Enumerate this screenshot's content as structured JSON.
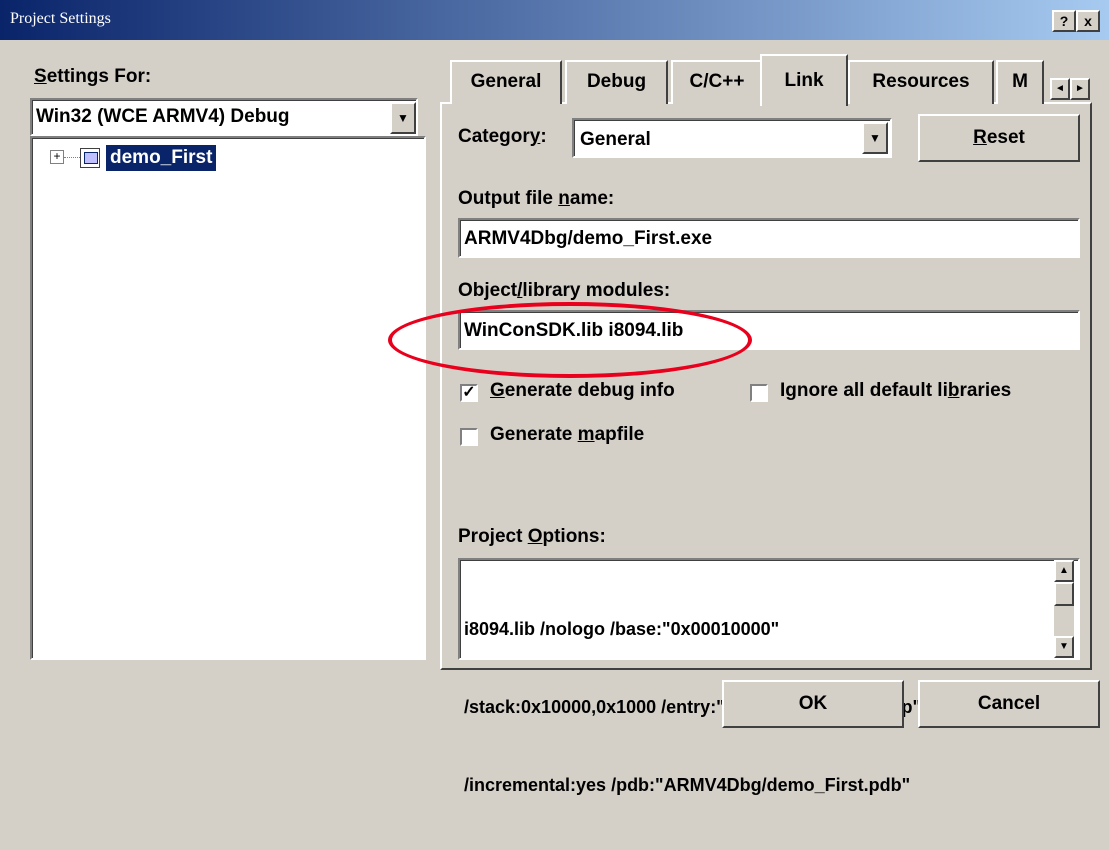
{
  "window": {
    "title": "Project Settings",
    "help_btn": "?",
    "close_btn": "x"
  },
  "left": {
    "settings_for_label": "Settings For:",
    "platform_value": "Win32 (WCE ARMV4) Debug",
    "tree_expander": "⊞",
    "tree_item": "demo_First"
  },
  "tabs": [
    {
      "label": "General"
    },
    {
      "label": "Debug"
    },
    {
      "label": "C/C++"
    },
    {
      "label": "Link"
    },
    {
      "label": "Resources"
    },
    {
      "label": "M"
    }
  ],
  "tab_scroll": {
    "left": "◄",
    "right": "►"
  },
  "link": {
    "category_label": "Category:",
    "category_value": "General",
    "reset_label": "Reset",
    "output_label": "Output file name:",
    "output_value": "ARMV4Dbg/demo_First.exe",
    "objlib_label": "Object/library modules:",
    "objlib_value": "WinConSDK.lib i8094.lib",
    "debug_info_label": "Generate debug info",
    "debug_info_checked": true,
    "ignore_libs_label": "Ignore all default libraries",
    "ignore_libs_checked": false,
    "mapfile_label": "Generate mapfile",
    "mapfile_checked": false,
    "project_options_label": "Project Options:",
    "project_options_lines": [
      "i8094.lib /nologo /base:\"0x00010000\"",
      "/stack:0x10000,0x1000 /entry:\"wWinMainCRTStartup\"",
      "/incremental:yes /pdb:\"ARMV4Dbg/demo_First.pdb\""
    ]
  },
  "buttons": {
    "ok": "OK",
    "cancel": "Cancel"
  },
  "colors": {
    "title_start": "#0a246a",
    "title_end": "#a6caf0",
    "face": "#d4d0c8",
    "highlight": "#0a246a",
    "annotation": "#e8001c"
  }
}
